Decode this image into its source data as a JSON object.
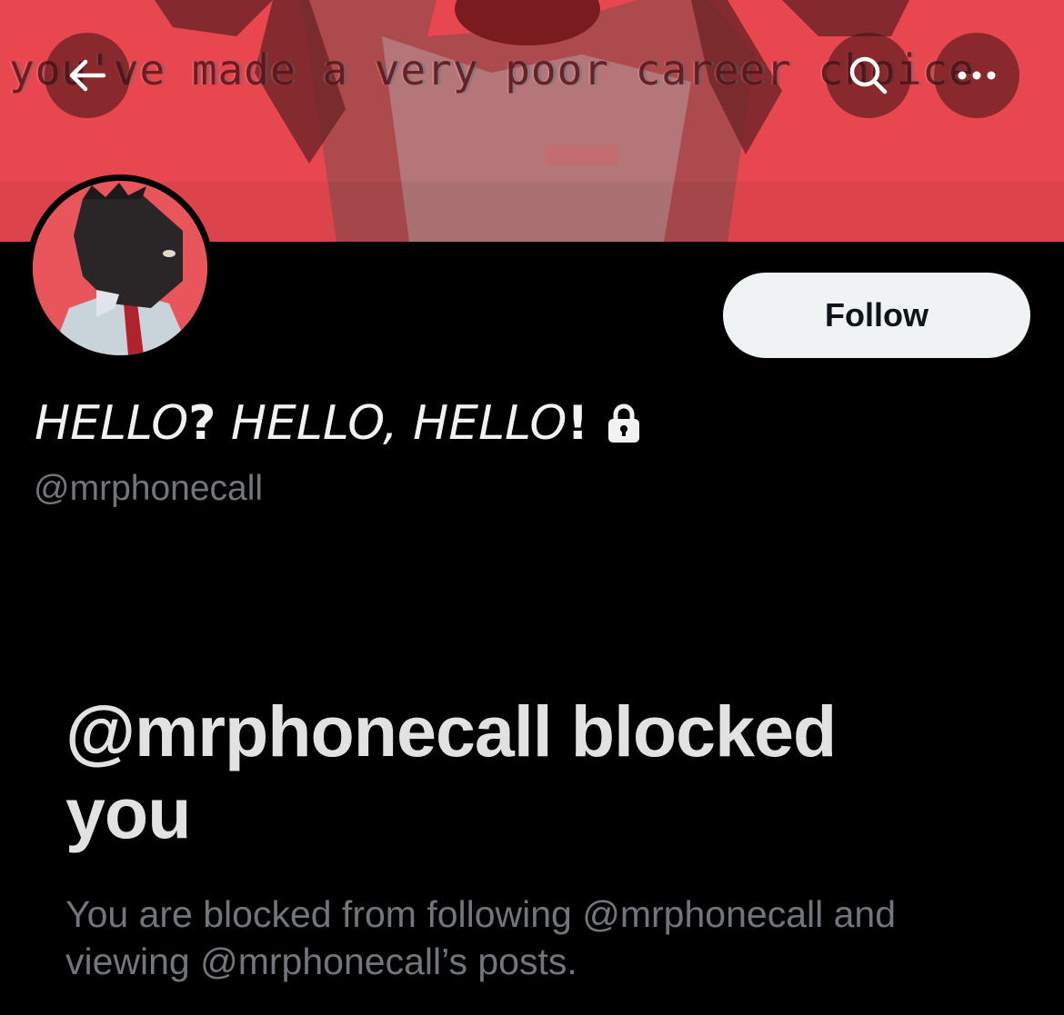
{
  "banner": {
    "text": "you've made a very poor career choice",
    "background_color": "#e8474f"
  },
  "header": {
    "back_icon": "arrow-left-icon",
    "search_icon": "search-icon",
    "more_icon": "more-horizontal-icon"
  },
  "profile": {
    "display_name_parts": [
      "HELLO",
      "?",
      " HELLO, HELLO",
      "!"
    ],
    "handle": "@mrphonecall",
    "protected_icon": "lock-icon",
    "follow_label": "Follow"
  },
  "blocked": {
    "title": "@mrphonecall blocked you",
    "description": "You are blocked from following @mrphonecall and viewing @mrphonecall’s posts."
  },
  "colors": {
    "background": "#000000",
    "follow_button_bg": "#eff3f4",
    "secondary_text": "#71767b",
    "primary_text": "#e7e9ea"
  }
}
